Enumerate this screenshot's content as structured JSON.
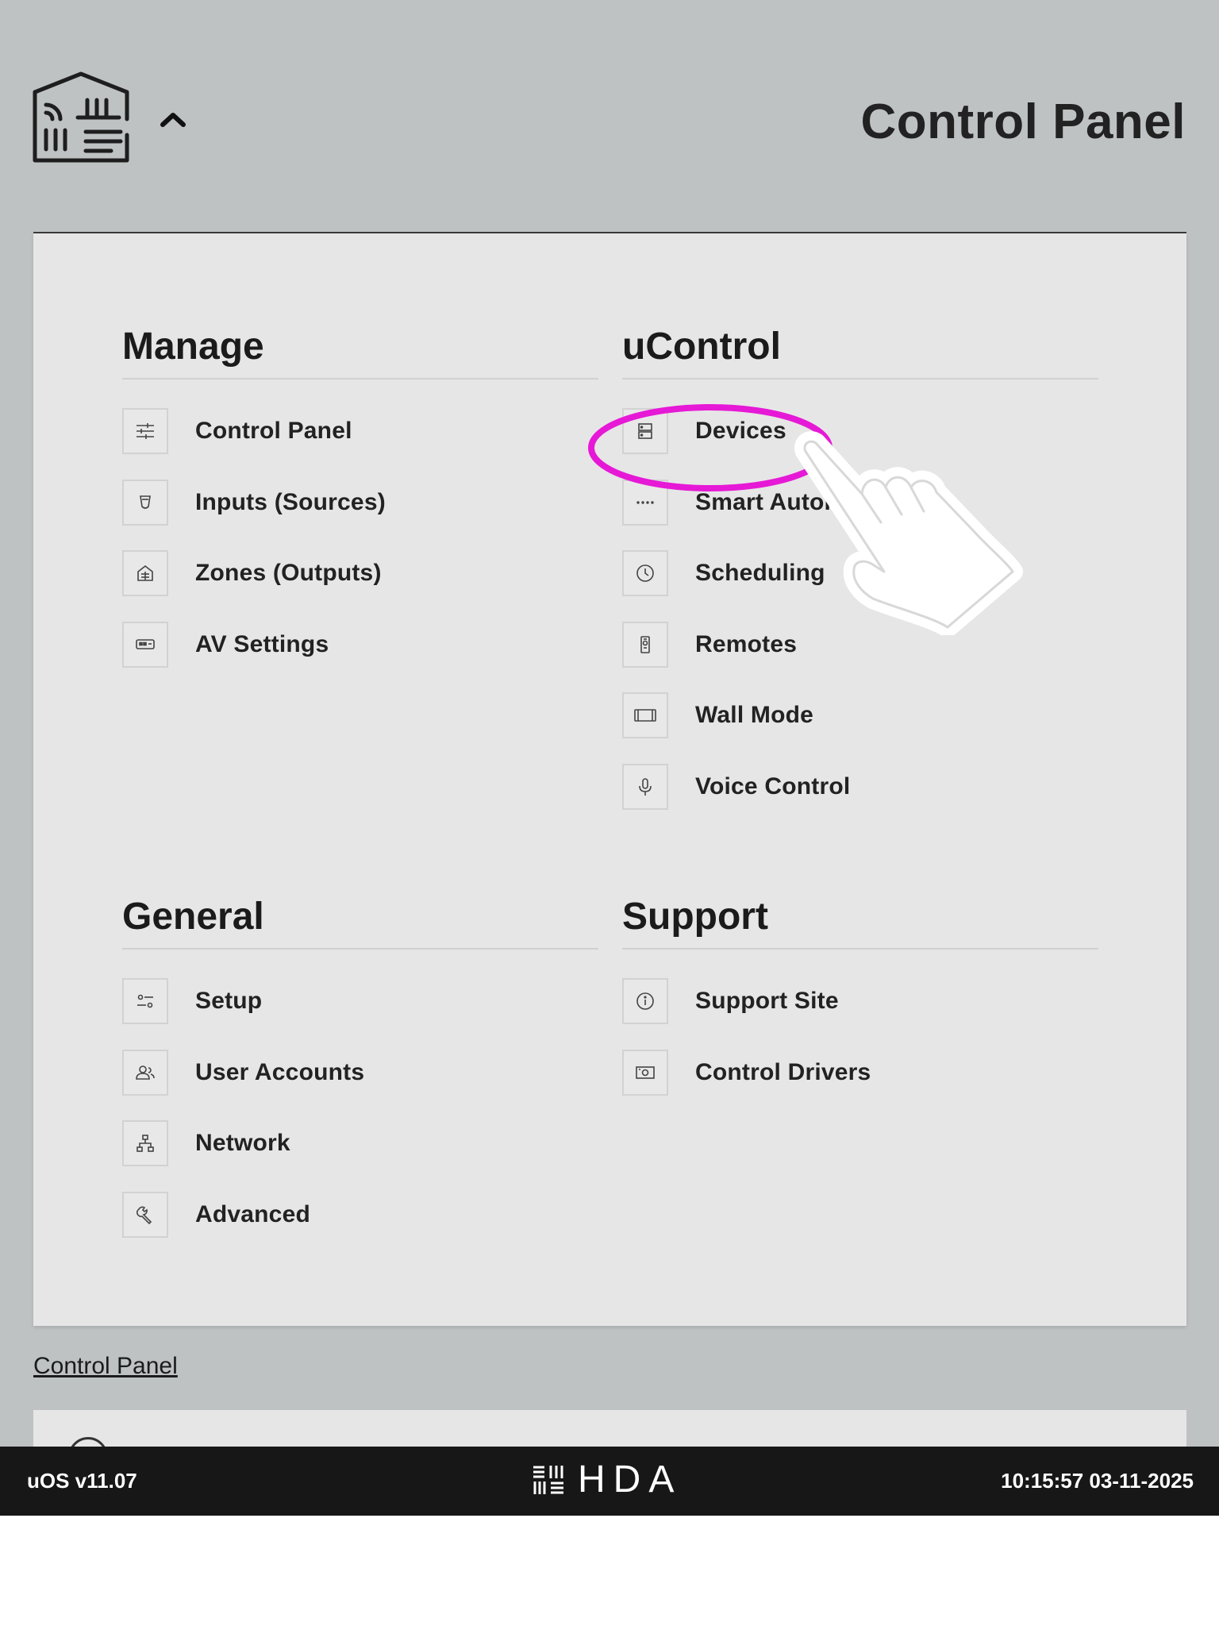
{
  "header": {
    "title": "Control Panel"
  },
  "sections": [
    {
      "title": "Manage",
      "items": [
        {
          "label": "Control Panel",
          "icon": "sliders-icon"
        },
        {
          "label": "Inputs (Sources)",
          "icon": "input-plug-icon"
        },
        {
          "label": "Zones (Outputs)",
          "icon": "house-icon"
        },
        {
          "label": "AV Settings",
          "icon": "av-box-icon"
        }
      ]
    },
    {
      "title": "uControl",
      "items": [
        {
          "label": "Devices",
          "icon": "server-icon"
        },
        {
          "label": "Smart Automations",
          "icon": "dots-icon"
        },
        {
          "label": "Scheduling",
          "icon": "clock-icon"
        },
        {
          "label": "Remotes",
          "icon": "remote-icon"
        },
        {
          "label": "Wall Mode",
          "icon": "tablet-icon"
        },
        {
          "label": "Voice Control",
          "icon": "microphone-icon"
        }
      ]
    },
    {
      "title": "General",
      "items": [
        {
          "label": "Setup",
          "icon": "toggles-icon"
        },
        {
          "label": "User Accounts",
          "icon": "users-icon"
        },
        {
          "label": "Network",
          "icon": "network-icon"
        },
        {
          "label": "Advanced",
          "icon": "wrench-icon"
        }
      ]
    },
    {
      "title": "Support",
      "items": [
        {
          "label": "Support Site",
          "icon": "info-icon"
        },
        {
          "label": "Control Drivers",
          "icon": "driver-icon"
        }
      ]
    }
  ],
  "breadcrumb": "Control Panel",
  "footer": {
    "version": "uOS v11.07",
    "brand": "HDA",
    "datetime": "10:15:57 03-11-2025"
  },
  "colors": {
    "highlight": "#e619d6",
    "background": "#bec2c3",
    "panel": "#e6e6e6",
    "footer": "#171717"
  }
}
